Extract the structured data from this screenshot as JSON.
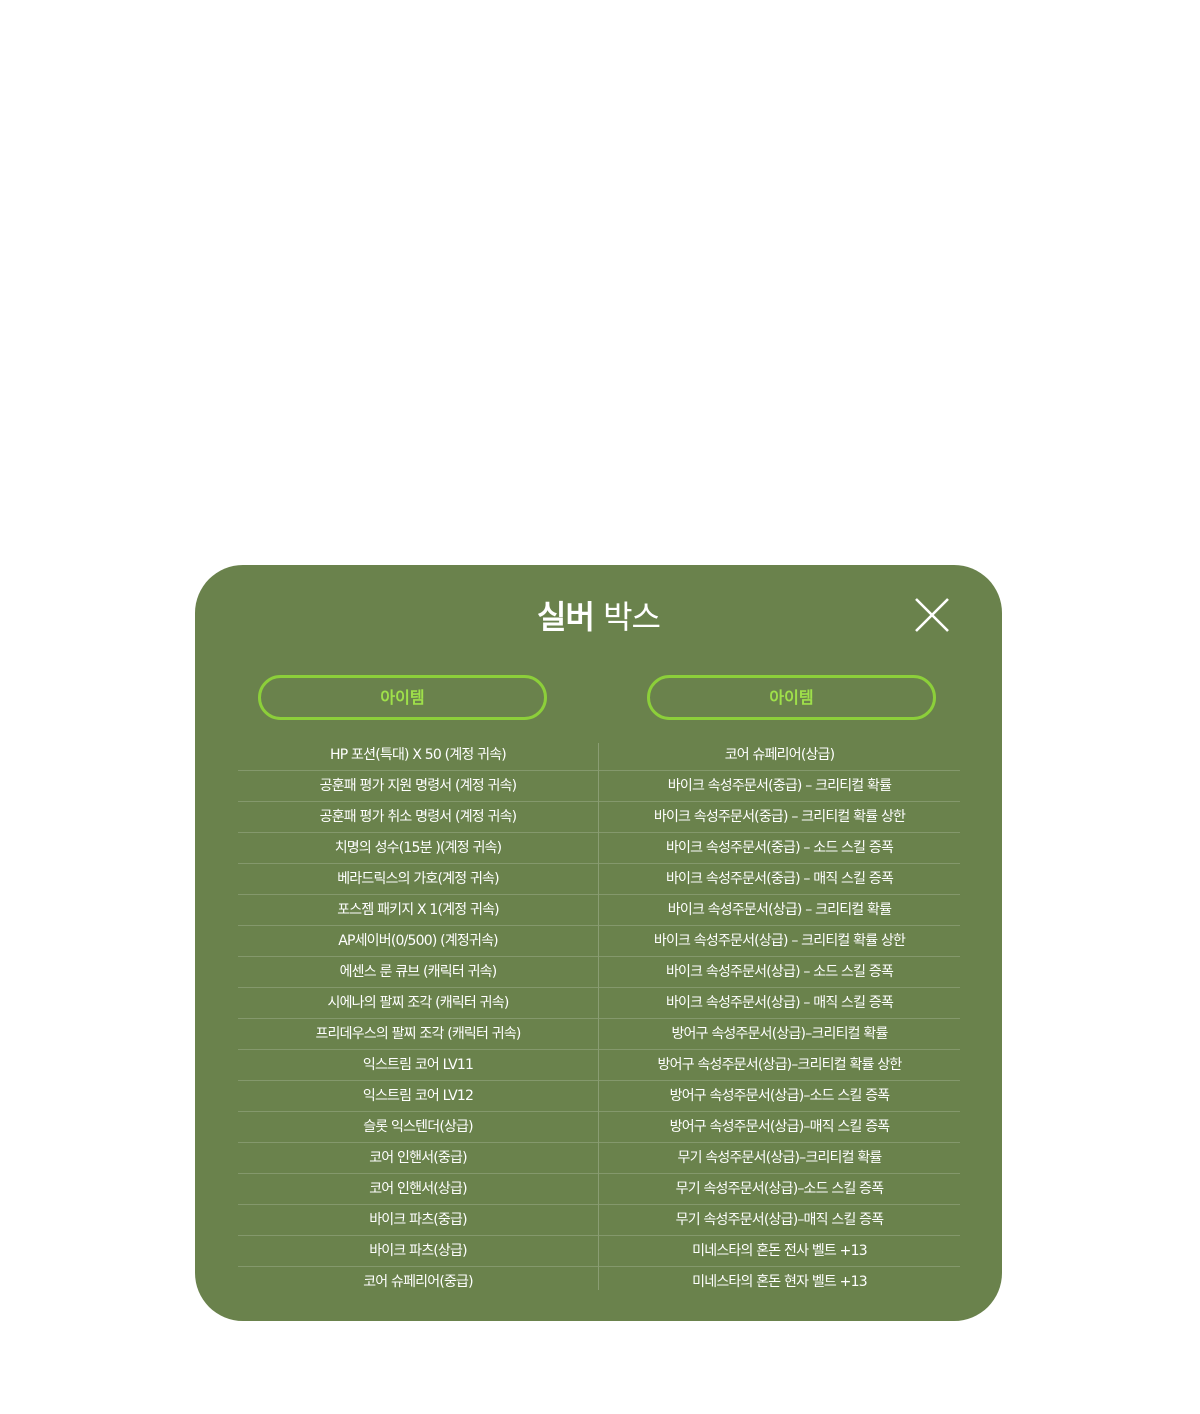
{
  "modal": {
    "title_bold": "실버",
    "title_light": "박스",
    "colors": {
      "background": "#6a824c",
      "accent": "#8ccf3a",
      "text": "#ffffff"
    }
  },
  "close": {
    "icon": "close-icon"
  },
  "columns": [
    {
      "header": "아이템",
      "items": [
        "HP 포션(특대) X 50 (계정 귀속)",
        "공훈패 평가 지원 명령서 (계정 귀속)",
        "공훈패 평가 취소 명령서 (계정 귀속)",
        "치명의 성수(15분 )(계정 귀속)",
        "베라드릭스의 가호(계정 귀속)",
        "포스젬 패키지 X 1(계정 귀속)",
        "AP세이버(0/500) (계정귀속)",
        "에센스 룬 큐브 (캐릭터 귀속)",
        "시에나의 팔찌 조각 (캐릭터 귀속)",
        "프리데우스의 팔찌 조각 (캐릭터 귀속)",
        "익스트림 코어 LV11",
        "익스트림 코어 LV12",
        "슬롯 익스텐더(상급)",
        "코어 인핸서(중급)",
        "코어 인핸서(상급)",
        "바이크 파츠(중급)",
        "바이크 파츠(상급)",
        "코어 슈페리어(중급)"
      ]
    },
    {
      "header": "아이템",
      "items": [
        "코어 슈페리어(상급)",
        "바이크 속성주문서(중급) – 크리티컬 확률",
        "바이크 속성주문서(중급) – 크리티컬 확률 상한",
        "바이크 속성주문서(중급) – 소드 스킬 증폭",
        "바이크 속성주문서(중급) – 매직 스킬 증폭",
        "바이크 속성주문서(상급) – 크리티컬 확률",
        "바이크 속성주문서(상급) – 크리티컬 확률 상한",
        "바이크 속성주문서(상급) – 소드 스킬 증폭",
        "바이크 속성주문서(상급) – 매직 스킬 증폭",
        "방어구 속성주문서(상급)–크리티컬 확률",
        "방어구 속성주문서(상급)–크리티컬 확률 상한",
        "방어구 속성주문서(상급)–소드 스킬 증폭",
        "방어구 속성주문서(상급)–매직 스킬 증폭",
        "무기 속성주문서(상급)–크리티컬 확률",
        "무기 속성주문서(상급)–소드 스킬 증폭",
        "무기 속성주문서(상급)–매직 스킬 증폭",
        "미네스타의 혼돈 전사 벨트 +13",
        "미네스타의 혼돈 현자 벨트 +13"
      ]
    }
  ]
}
